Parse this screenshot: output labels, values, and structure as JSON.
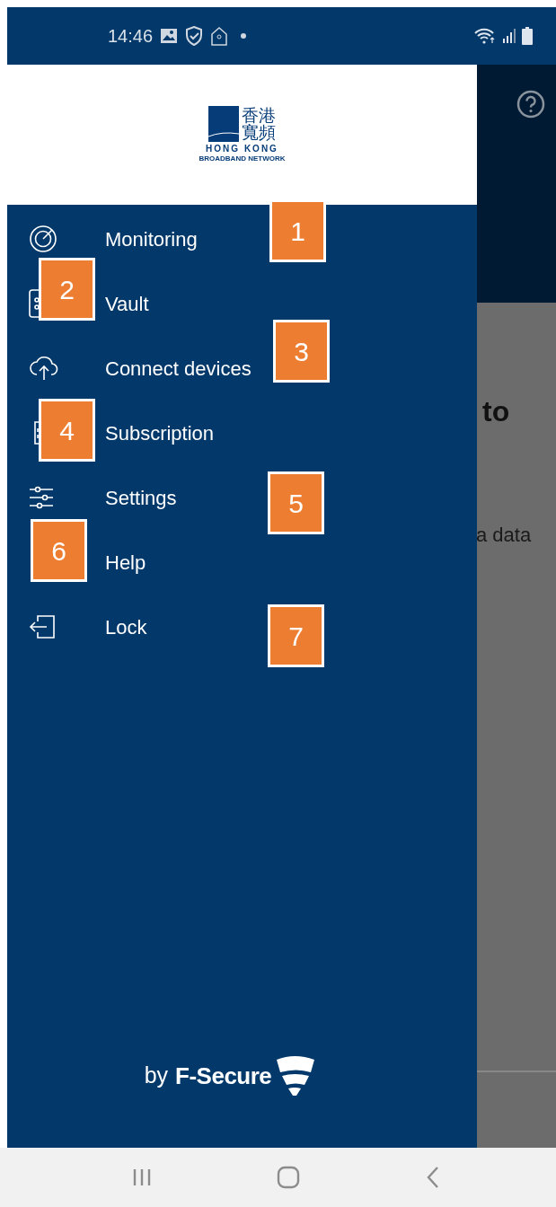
{
  "status_bar": {
    "time": "14:46"
  },
  "background_screen": {
    "heading_fragment": "to",
    "body_fragment": "a data"
  },
  "drawer": {
    "logo": {
      "chinese_line_1": "香港",
      "chinese_line_2": "寬頻",
      "name": "HONG KONG",
      "tagline": "BROADBAND NETWORK"
    },
    "items": [
      {
        "label": "Monitoring",
        "kind": "monitoring"
      },
      {
        "label": "Vault",
        "kind": "vault"
      },
      {
        "label": "Connect devices",
        "kind": "connect"
      },
      {
        "label": "Subscription",
        "kind": "subscription"
      },
      {
        "label": "Settings",
        "kind": "settings"
      },
      {
        "label": "Help",
        "kind": "help"
      },
      {
        "label": "Lock",
        "kind": "lock"
      }
    ],
    "footer": {
      "prefix": "by",
      "brand": "F-Secure"
    }
  },
  "callouts": [
    "1",
    "2",
    "3",
    "4",
    "5",
    "6",
    "7"
  ]
}
